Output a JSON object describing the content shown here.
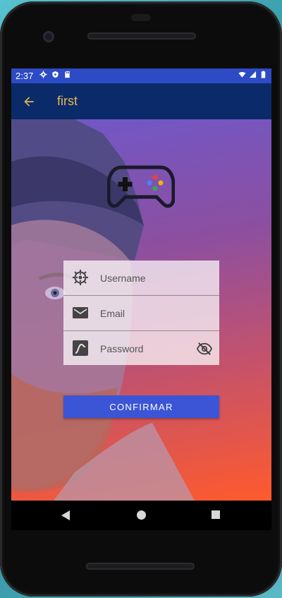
{
  "status_bar": {
    "time": "2:37",
    "left_icons": [
      "settings-icon",
      "shield-icon",
      "sd-card-icon"
    ],
    "right_icons": [
      "wifi-icon",
      "signal-icon",
      "battery-icon"
    ]
  },
  "app_bar": {
    "title": "first",
    "back_icon": "arrow-back-icon",
    "title_color": "#e6b84a",
    "background": "#0a2a6a"
  },
  "logo": {
    "icon": "gamepad-icon"
  },
  "form": {
    "username": {
      "placeholder": "Username",
      "value": "",
      "icon": "settings-gear-icon"
    },
    "email": {
      "placeholder": "Email",
      "value": "",
      "icon": "mail-icon"
    },
    "password": {
      "placeholder": "Password",
      "value": "",
      "icon": "signature-icon",
      "toggle_icon": "visibility-off-icon"
    }
  },
  "confirm_button": {
    "label": "CONFIRMAR",
    "color": "#3b55d6"
  },
  "nav_bar": {
    "icons": [
      "nav-back-icon",
      "nav-home-icon",
      "nav-recents-icon"
    ]
  }
}
